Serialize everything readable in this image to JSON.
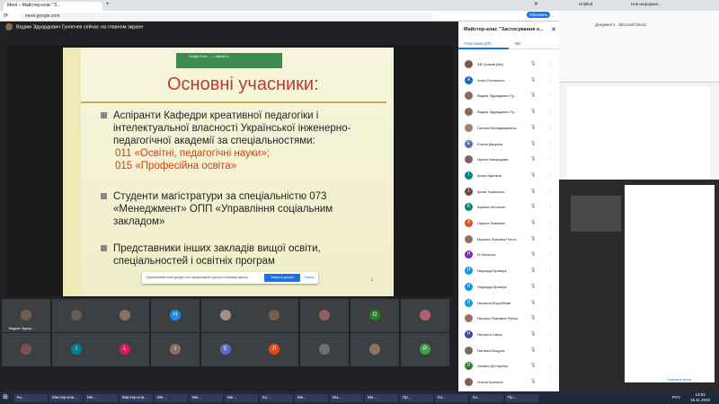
{
  "browser": {
    "tab1": "Meet – Майстер-клас \"З...",
    "url": "meet.google.com",
    "profile_badge": "Обновить"
  },
  "meet": {
    "presenter_text": "Вадим Эдуардович Гуняпчек сейчас на главном экране",
    "tile_self_name": "Вадим Эдуар..."
  },
  "slide": {
    "banner_text": "Google Docs ... — natural to…",
    "title": "Основні учасники:",
    "bullet1_lines": [
      "Аспіранти Кафедри креативної педагогіки і",
      "інтелектуальної власності Української інженерно-",
      "педагогічної академії за спеціальностями:"
    ],
    "bullet1_red": [
      "011 «Освітні, педагогічні науки»;",
      "015 «Професійна освіта»"
    ],
    "bullet2_lines": [
      "Студенти магістратури за спеціальністю 073",
      "«Менеджмент» ОПП «Управління соціальним",
      "закладом»"
    ],
    "bullet3_lines": [
      "Представники інших закладів вищої освіти,",
      "спеціальностей і освітніх програм"
    ],
    "page_number": "2",
    "notice_text": "Приложению meet.google.com предоставлен доступ к вашему экрану",
    "notice_button": "Закрыть доступ",
    "notice_hide": "Скрыть"
  },
  "tiles": [
    {
      "letter": "",
      "color": "#7a5a4a"
    },
    {
      "letter": "",
      "color": "#6b5a50"
    },
    {
      "letter": "",
      "color": "#8a7060"
    },
    {
      "letter": "Н",
      "color": "#1e88e5"
    },
    {
      "letter": "",
      "color": "#a89080"
    },
    {
      "letter": "",
      "color": "#706050"
    },
    {
      "letter": "",
      "color": "#906060"
    },
    {
      "letter": "О",
      "color": "#2e7d32"
    },
    {
      "letter": "",
      "color": "#b06070"
    },
    {
      "letter": "",
      "color": "#805050"
    },
    {
      "letter": "І",
      "color": "#00838f"
    },
    {
      "letter": "L",
      "color": "#d81b60"
    },
    {
      "letter": "І",
      "color": "#8d6e63"
    },
    {
      "letter": "Е",
      "color": "#5c6bc0"
    },
    {
      "letter": "Л",
      "color": "#e64a19"
    },
    {
      "letter": "",
      "color": "#707070"
    },
    {
      "letter": "",
      "color": "#907060"
    },
    {
      "letter": "Р",
      "color": "#43a047"
    }
  ],
  "panel": {
    "title": "Майстер-клас \"Застосування о...",
    "tab_people": "Участники (20)",
    "tab_chat": "Чат",
    "participants": [
      {
        "name": "ЕВ Громов (Вы)",
        "letter": "",
        "color": "#7a5a4a"
      },
      {
        "name": "Алла Остапенко",
        "letter": "А",
        "color": "#1565c0"
      },
      {
        "name": "Вадим Эдуардович Гу...",
        "letter": "",
        "color": "#8a6a55"
      },
      {
        "name": "Вадим Эдуардович Гу...",
        "letter": "",
        "color": "#8a6a55"
      },
      {
        "name": "Галина Володимирівна...",
        "letter": "",
        "color": "#a08070"
      },
      {
        "name": "Елена Дворник",
        "letter": "Е",
        "color": "#5c6bc0"
      },
      {
        "name": "Ирина Ниефедова",
        "letter": "",
        "color": "#806060"
      },
      {
        "name": "Ірина Афоніна",
        "letter": "І",
        "color": "#00838f"
      },
      {
        "name": "Ірина Тарасенко",
        "letter": "І",
        "color": "#6d4c41"
      },
      {
        "name": "Карина Китченко",
        "letter": "К",
        "color": "#00897b"
      },
      {
        "name": "Лариса Фоменко",
        "letter": "Л",
        "color": "#e64a19"
      },
      {
        "name": "Марина Львовна Росто...",
        "letter": "",
        "color": "#907060"
      },
      {
        "name": "Ні Фесенко",
        "letter": "Н",
        "color": "#8e24aa"
      },
      {
        "name": "Надежда Кравчук",
        "letter": "Н",
        "color": "#039be5"
      },
      {
        "name": "Надежда Кравчук",
        "letter": "Н",
        "color": "#039be5"
      },
      {
        "name": "Наталия Воробйова",
        "letter": "Н",
        "color": "#039be5"
      },
      {
        "name": "Наталія Павлівна Рубан",
        "letter": "",
        "color": "#a06a60"
      },
      {
        "name": "Наталья Сімор",
        "letter": "Н",
        "color": "#3949ab"
      },
      {
        "name": "Наталья Бацула",
        "letter": "",
        "color": "#7a6a60"
      },
      {
        "name": "Оксана Дегтярева",
        "letter": "О",
        "color": "#2e7d32"
      },
      {
        "name": "Олена Кутюхин",
        "letter": "",
        "color": "#806050"
      }
    ]
  },
  "right": {
    "tab": "Untitled",
    "tab2": "Нов информат...",
    "title": "Документ1 - Microsoft Word",
    "share_label": "Показать всем"
  },
  "taskbar": {
    "items": [
      "Ко...",
      "Мастер-кла...",
      "Ме...",
      "Мастер-кла...",
      "Ме...",
      "Ме...",
      "Ме...",
      "Ко...",
      "Ме...",
      "Мо...",
      "Ме...",
      "Пр...",
      "Ко...",
      "Ко...",
      "Пр..."
    ],
    "lang": "РУС",
    "time": "13:04",
    "date": "16.11.2020"
  }
}
